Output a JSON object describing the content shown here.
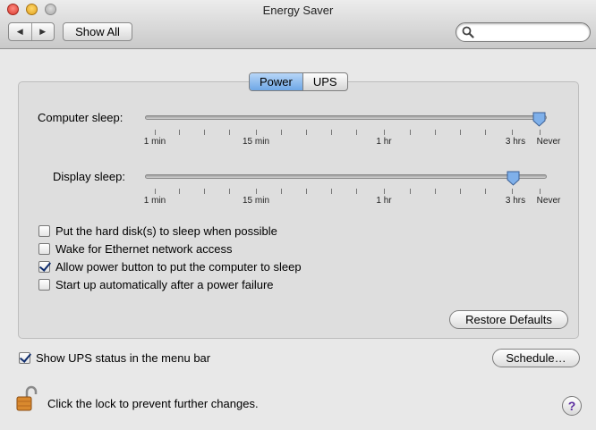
{
  "window": {
    "title": "Energy Saver"
  },
  "toolbar": {
    "back_icon": "back-arrow-icon",
    "forward_icon": "forward-arrow-icon",
    "show_all_label": "Show All",
    "search_placeholder": "",
    "search_icon": "magnifier-icon"
  },
  "tabs": [
    {
      "label": "Power",
      "selected": true
    },
    {
      "label": "UPS",
      "selected": false
    }
  ],
  "computer_sleep": {
    "label": "Computer sleep:",
    "value": "Never",
    "tick_labels": [
      "1 min",
      "15 min",
      "1 hr",
      "3 hrs",
      "Never"
    ]
  },
  "display_sleep": {
    "label": "Display sleep:",
    "value": "3 hrs",
    "tick_labels": [
      "1 min",
      "15 min",
      "1 hr",
      "3 hrs",
      "Never"
    ]
  },
  "options": [
    {
      "label": "Put the hard disk(s) to sleep when possible",
      "checked": false
    },
    {
      "label": "Wake for Ethernet network access",
      "checked": false
    },
    {
      "label": "Allow power button to put the computer to sleep",
      "checked": true
    },
    {
      "label": "Start up automatically after a power failure",
      "checked": false
    }
  ],
  "restore_defaults_label": "Restore Defaults",
  "show_ups_status": {
    "label": "Show UPS status in the menu bar",
    "checked": true
  },
  "schedule_label": "Schedule…",
  "lock": {
    "icon": "unlocked-padlock-icon",
    "text": "Click the lock to prevent further changes."
  },
  "help": {
    "icon": "help-icon",
    "label": "?"
  },
  "colors": {
    "selected_segment": "#6ea7e6",
    "checkmark": "#0f2d6e",
    "help_glyph": "#5b2ca0"
  }
}
